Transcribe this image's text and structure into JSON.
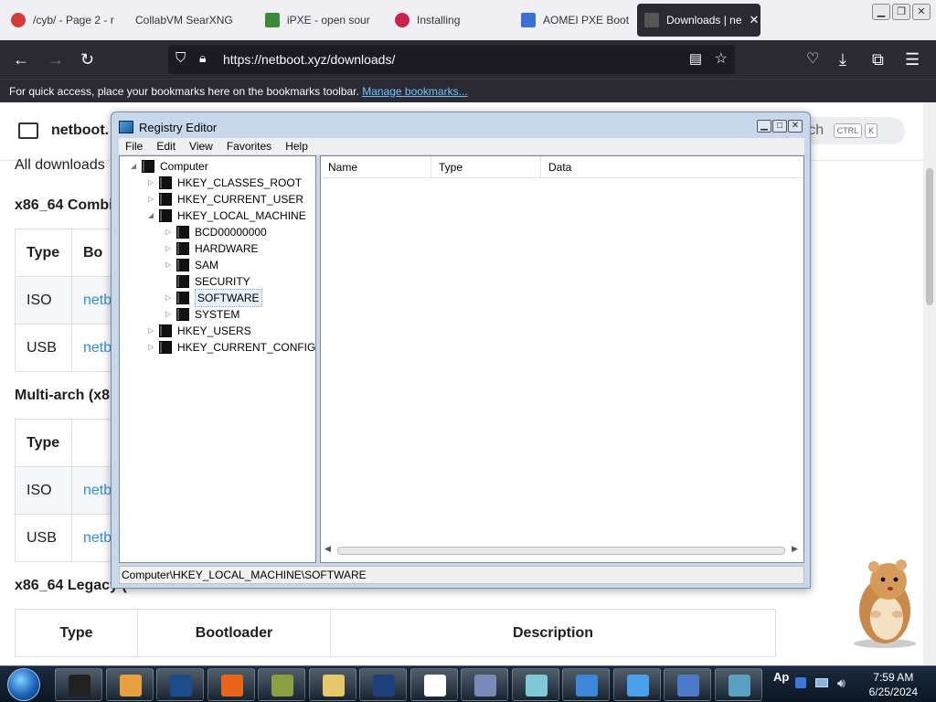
{
  "browser": {
    "tabs": [
      {
        "title": "/cyb/ - Page 2 - r",
        "color": "#d63b3b"
      },
      {
        "title": "CollabVM SearXNG",
        "color": ""
      },
      {
        "title": "iPXE - open sour",
        "color": "#3a8a3a"
      },
      {
        "title": "Installing",
        "color": "#c8224d"
      },
      {
        "title": "AOMEI PXE Boot",
        "color": "#3b6fd6"
      },
      {
        "title": "Downloads | ne",
        "color": "#555555"
      }
    ],
    "url": "https://netboot.xyz/downloads/",
    "bookmarks_text": "For quick access, place your bookmarks here on the bookmarks toolbar.",
    "bookmarks_link": "Manage bookmarks..."
  },
  "site": {
    "title": "netboot.",
    "search_text": "arch",
    "kbd1": "CTRL",
    "kbd2": "K",
    "breadcrumb": "All downloads",
    "section1": "x86_64 Combi",
    "section2": "Multi-arch (x8",
    "section3": "x86_64 Legacy (",
    "col_type": "Type",
    "col_bo": "Bo",
    "rows": [
      {
        "type": "ISO",
        "link": "netb"
      },
      {
        "type": "USB",
        "link": "netb"
      }
    ],
    "rows2": [
      {
        "type": "ISO",
        "link": "netb"
      },
      {
        "type": "USB",
        "link": "netb"
      }
    ],
    "legacy_headers": [
      "Type",
      "Bootloader",
      "Description"
    ]
  },
  "regedit": {
    "title": "Registry Editor",
    "menu": [
      "File",
      "Edit",
      "View",
      "Favorites",
      "Help"
    ],
    "columns": [
      "Name",
      "Type",
      "Data"
    ],
    "tree": [
      {
        "label": "Computer",
        "level": 0,
        "toggle": "◢"
      },
      {
        "label": "HKEY_CLASSES_ROOT",
        "level": 1,
        "toggle": "▷"
      },
      {
        "label": "HKEY_CURRENT_USER",
        "level": 1,
        "toggle": "▷"
      },
      {
        "label": "HKEY_LOCAL_MACHINE",
        "level": 1,
        "toggle": "◢"
      },
      {
        "label": "BCD00000000",
        "level": 2,
        "toggle": "▷"
      },
      {
        "label": "HARDWARE",
        "level": 2,
        "toggle": "▷"
      },
      {
        "label": "SAM",
        "level": 2,
        "toggle": "▷"
      },
      {
        "label": "SECURITY",
        "level": 2,
        "toggle": ""
      },
      {
        "label": "SOFTWARE",
        "level": 2,
        "toggle": "▷",
        "selected": true
      },
      {
        "label": "SYSTEM",
        "level": 2,
        "toggle": "▷"
      },
      {
        "label": "HKEY_USERS",
        "level": 1,
        "toggle": "▷"
      },
      {
        "label": "HKEY_CURRENT_CONFIG",
        "level": 1,
        "toggle": "▷"
      }
    ],
    "status_path": "Computer\\HKEY_LOCAL_MACHINE\\SOFTWARE"
  },
  "taskbar": {
    "time": "7:59 AM",
    "date": "6/25/2024",
    "apps": [
      {
        "name": "terminal",
        "color": "#222222"
      },
      {
        "name": "media-player",
        "color": "#e8a040"
      },
      {
        "name": "globe",
        "color": "#1b4d8a"
      },
      {
        "name": "firefox",
        "color": "#e8661c"
      },
      {
        "name": "box-game",
        "color": "#8aa040"
      },
      {
        "name": "file-explorer",
        "color": "#e6c86a"
      },
      {
        "name": "display",
        "color": "#1d3f7a"
      },
      {
        "name": "7zip",
        "color": "#ffffff"
      },
      {
        "name": "network-app",
        "color": "#7a8ab8"
      },
      {
        "name": "notepad",
        "color": "#7fc8d8"
      },
      {
        "name": "sync-app",
        "color": "#3b86d6"
      },
      {
        "name": "refresh-app",
        "color": "#4aa0e8"
      },
      {
        "name": "control-panel",
        "color": "#4a7ac8"
      },
      {
        "name": "registry-app",
        "color": "#5aa0c0"
      }
    ],
    "tray_text": "Ap"
  }
}
